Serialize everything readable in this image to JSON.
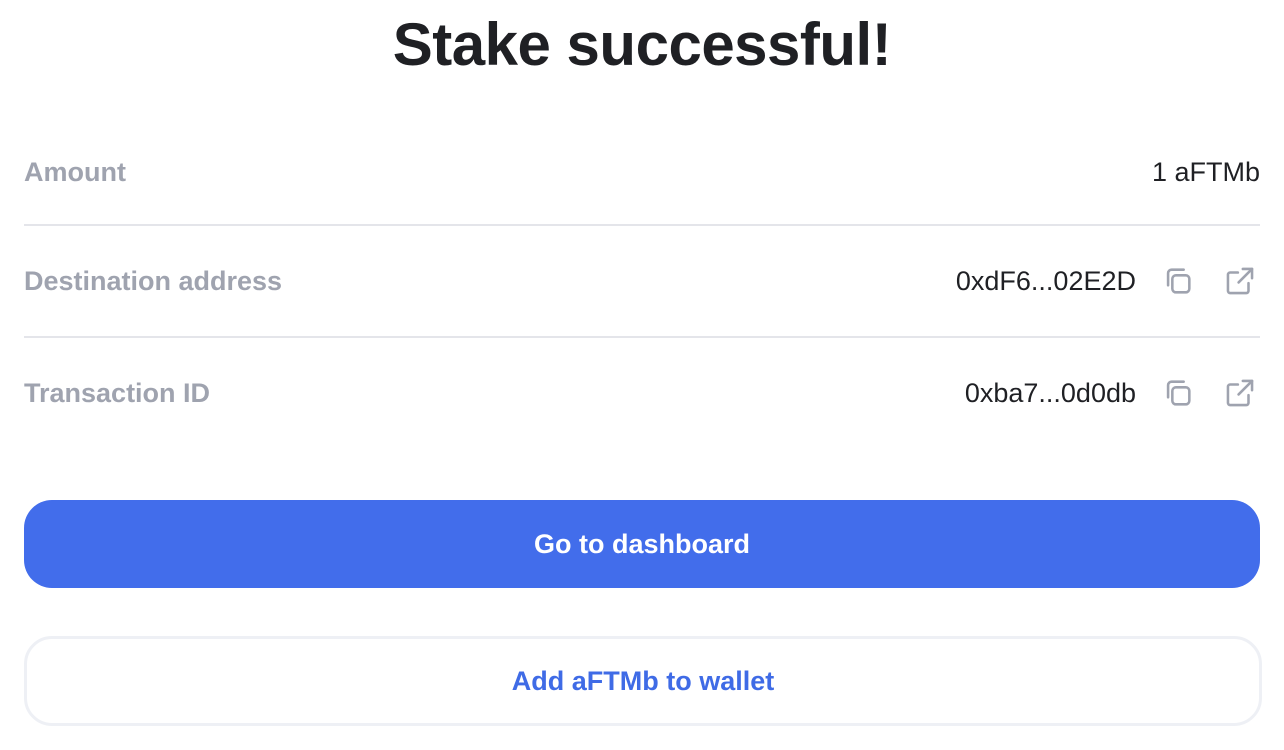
{
  "title": "Stake successful!",
  "details": {
    "amount": {
      "label": "Amount",
      "value": "1 aFTMb"
    },
    "destination": {
      "label": "Destination address",
      "value": "0xdF6...02E2D"
    },
    "transaction": {
      "label": "Transaction ID",
      "value": "0xba7...0d0db"
    }
  },
  "actions": {
    "primary_label": "Go to dashboard",
    "secondary_label": "Add aFTMb to wallet"
  },
  "icons": {
    "copy": "copy-icon",
    "external": "external-link-icon"
  },
  "colors": {
    "accent": "#426deb",
    "label": "#9fa3af",
    "text": "#1f2024"
  }
}
